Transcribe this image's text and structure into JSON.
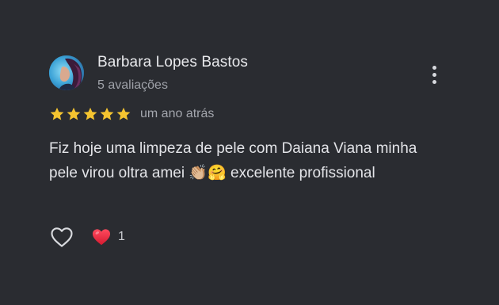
{
  "review": {
    "author_name": "Barbara Lopes Bastos",
    "author_meta": "5 avaliações",
    "rating": 5,
    "rating_max": 5,
    "date": "um ano atrás",
    "text_part1": "Fiz hoje uma limpeza de pele com Daiana Viana minha pele virou oltra amei",
    "emoji_1": "👏🏼",
    "emoji_2": "🤗",
    "text_part2": "excelente profissional",
    "reaction_count": "1"
  },
  "icons": {
    "avatar": "avatar-photo",
    "more": "more-vertical-icon",
    "star": "star-icon",
    "like": "heart-outline-icon",
    "reaction": "heart-filled-icon"
  },
  "colors": {
    "background": "#2a2c31",
    "star": "#f4c430",
    "heart": "#e0243a",
    "text_primary": "#e6e7ea",
    "text_secondary": "#9ea1a8"
  }
}
